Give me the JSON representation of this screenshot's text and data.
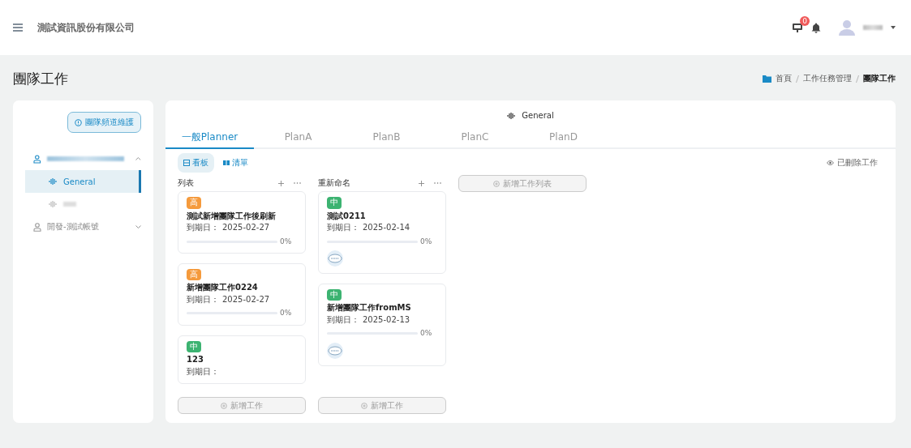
{
  "header": {
    "company": "測試資訊股份有限公司",
    "notification_badge": "0"
  },
  "page_title": "團隊工作",
  "breadcrumb": [
    {
      "label": "首頁",
      "current": false
    },
    {
      "label": "工作任務管理",
      "current": false
    },
    {
      "label": "團隊工作",
      "current": true
    }
  ],
  "sidebar": {
    "maintain_button": "團隊頻道維護",
    "teams": [
      {
        "expanded": true,
        "children": [
          {
            "label": "General",
            "selected": true
          },
          {
            "selected": false
          }
        ]
      },
      {
        "label": "開發-測試帳號",
        "expanded": false
      }
    ]
  },
  "channel_title": "General",
  "tabs": [
    {
      "label": "一般Planner",
      "selected": true
    },
    {
      "label": "PlanA",
      "selected": false
    },
    {
      "label": "PlanB",
      "selected": false
    },
    {
      "label": "PlanC",
      "selected": false
    },
    {
      "label": "PlanD",
      "selected": false
    }
  ],
  "views": [
    {
      "label": "看板",
      "selected": true
    },
    {
      "label": "清單",
      "selected": false
    }
  ],
  "deleted_link": "已刪除工作",
  "add_list_button": "新增工作列表",
  "lists": [
    {
      "name": "列表",
      "add_task": "新增工作",
      "tasks": [
        {
          "priority": "高",
          "color": "#f59a3c",
          "title": "測試新增團隊工作後刷新",
          "due_label": "到期日：",
          "due": "2025-02-27",
          "level": 0,
          "percent": "0%"
        },
        {
          "priority": "高",
          "color": "#f59a3c",
          "title": "新增團隊工作0224",
          "due_label": "到期日：",
          "due": "2025-02-27",
          "level": 0,
          "percent": "0%"
        },
        {
          "priority": "中",
          "color": "#3cb371",
          "title": "123",
          "due_label": "到期日："
        }
      ]
    },
    {
      "name": "重新命名",
      "add_task": "新增工作",
      "tasks": [
        {
          "priority": "中",
          "color": "#3cb371",
          "title": "測試0211",
          "due_label": "到期日：",
          "due": "2025-02-14",
          "level": 0,
          "percent": "0%",
          "assignee": true
        },
        {
          "priority": "中",
          "color": "#3cb371",
          "title": "新增團隊工作fromMS",
          "due_label": "到期日：",
          "due": "2025-02-13",
          "level": 0,
          "percent": "0%",
          "assignee": true
        }
      ]
    }
  ]
}
